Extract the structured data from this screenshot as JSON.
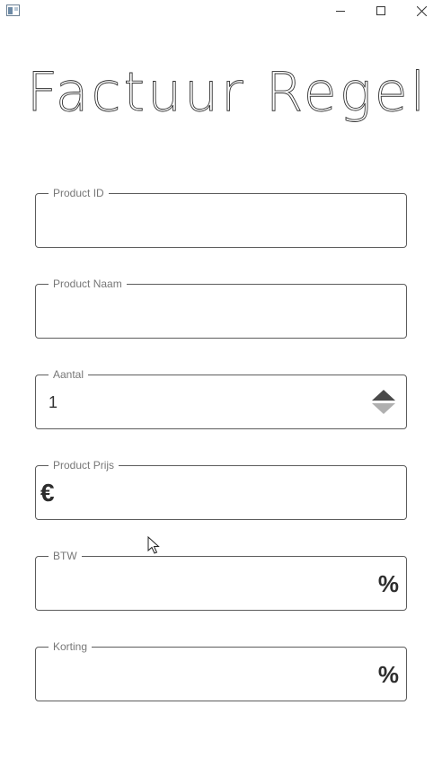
{
  "window": {
    "title": "",
    "icons": {
      "app": "app-icon",
      "minimize": "minimize-icon",
      "maximize": "maximize-icon",
      "close": "close-icon"
    }
  },
  "page": {
    "title": "Factuur Regel"
  },
  "form": {
    "product_id": {
      "label": "Product ID",
      "value": ""
    },
    "product_naam": {
      "label": "Product Naam",
      "value": ""
    },
    "aantal": {
      "label": "Aantal",
      "value": "1"
    },
    "product_prijs": {
      "label": "Product Prijs",
      "value": "",
      "prefix": "€"
    },
    "btw": {
      "label": "BTW",
      "value": "",
      "suffix": "%"
    },
    "korting": {
      "label": "Korting",
      "value": "",
      "suffix": "%"
    }
  },
  "colors": {
    "border": "#5c5c5c",
    "label": "#777777",
    "text": "#333333",
    "stepper_up": "#4a4a4a",
    "stepper_down": "#b0b0b0"
  }
}
